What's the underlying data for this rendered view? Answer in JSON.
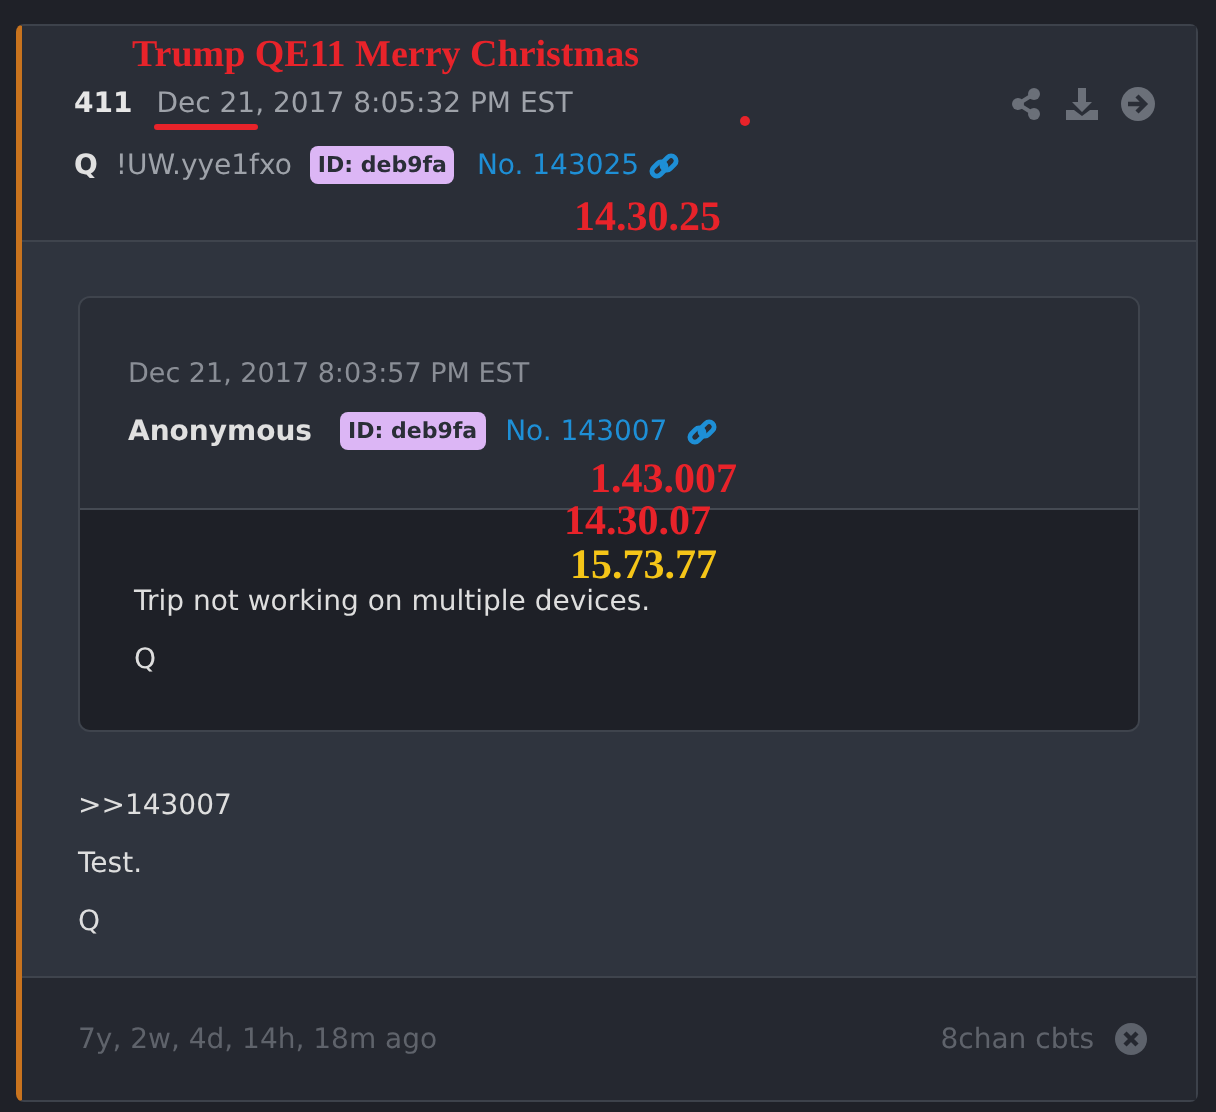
{
  "post": {
    "number": "411",
    "date": "Dec 21, 2017 8:05:32 PM EST",
    "author": "Q",
    "tripcode": "!UW.yye1fxo",
    "id_badge": "ID: deb9fa",
    "post_no": "No. 143025",
    "quote": {
      "date": "Dec 21, 2017 8:03:57 PM EST",
      "author": "Anonymous",
      "id_badge": "ID: deb9fa",
      "post_no": "No. 143007",
      "lines": [
        "Trip not working on multiple devices.",
        "Q"
      ]
    },
    "lines": [
      ">>143007",
      "Test.",
      "Q"
    ],
    "footer": {
      "age": "7y, 2w, 4d, 14h, 18m ago",
      "source": "8chan cbts"
    }
  },
  "annotations": [
    {
      "text": "Trump  QE11 Merry Christmas",
      "color": "#e8232a"
    },
    {
      "text": "14.30.25",
      "color": "#e8232a"
    },
    {
      "text": "1.43.007",
      "color": "#e8232a"
    },
    {
      "text": "14.30.07",
      "color": "#e8232a"
    },
    {
      "text": "15.73.77",
      "color": "#f5c518"
    }
  ]
}
